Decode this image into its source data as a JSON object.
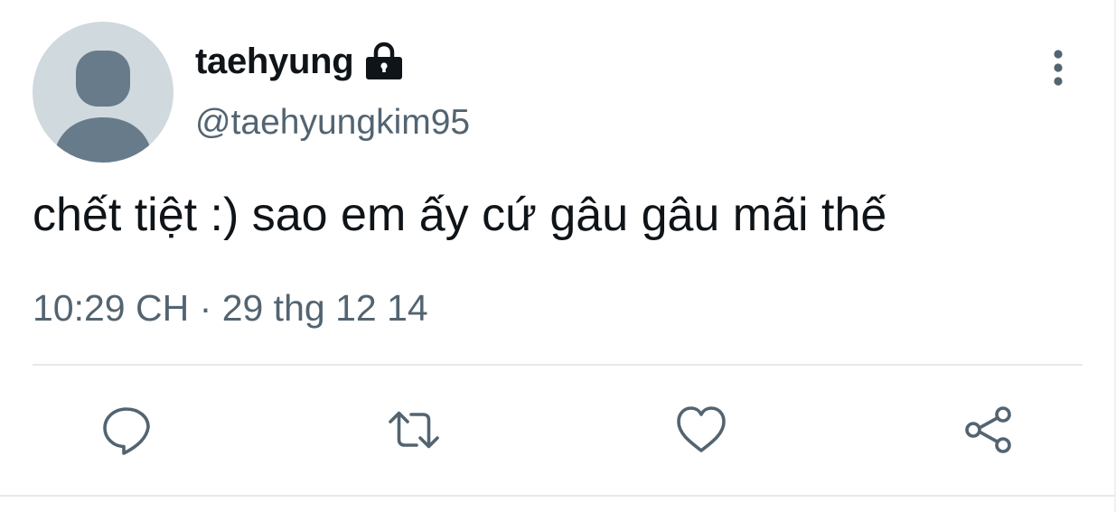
{
  "tweet": {
    "author": {
      "display_name": "taehyung",
      "handle": "@taehyungkim95",
      "protected_icon": "lock-icon",
      "avatar": "default-avatar"
    },
    "text": "chết tiệt :) sao em ấy cứ gâu gâu mãi thế",
    "time": "10:29 CH",
    "separator": "·",
    "date": "29 thg 12 14",
    "menu_icon": "more-vertical-icon"
  },
  "actions": [
    {
      "name": "reply",
      "icon": "comment-icon"
    },
    {
      "name": "retweet",
      "icon": "retweet-icon"
    },
    {
      "name": "like",
      "icon": "heart-icon"
    },
    {
      "name": "share",
      "icon": "share-icon"
    }
  ],
  "colors": {
    "text_primary": "#0f1419",
    "text_secondary": "#536471",
    "avatar_bg": "#cfd9de",
    "avatar_fg": "#687b8b",
    "divider": "#e5e9ec"
  }
}
